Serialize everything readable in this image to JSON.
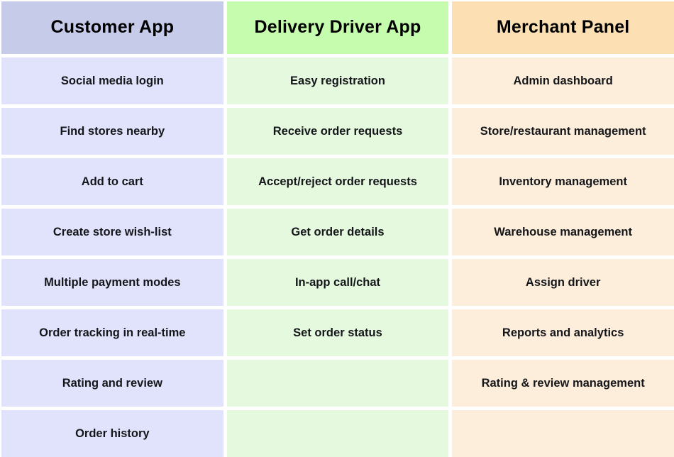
{
  "table": {
    "title": "Customer App / Delivery Driver App / Merchant Panel feature comparison",
    "columns": [
      {
        "id": "customer-app",
        "header": "Customer App",
        "header_color": "#c6cbea",
        "body_color": "#e1e3fd"
      },
      {
        "id": "delivery-driver-app",
        "header": "Delivery Driver App",
        "header_color": "#c6fcad",
        "body_color": "#e5f9df"
      },
      {
        "id": "merchant-panel",
        "header": "Merchant Panel",
        "header_color": "#fce0b4",
        "body_color": "#fdeedb"
      }
    ],
    "rows": [
      [
        "Social media login",
        "Easy registration",
        "Admin dashboard"
      ],
      [
        "Find stores nearby",
        "Receive order requests",
        "Store/restaurant management"
      ],
      [
        "Add to cart",
        "Accept/reject order requests",
        "Inventory management"
      ],
      [
        "Create store wish-list",
        "Get order details",
        "Warehouse management"
      ],
      [
        "Multiple payment modes",
        "In-app call/chat",
        "Assign driver"
      ],
      [
        "Order tracking in real-time",
        "Set order status",
        "Reports and analytics"
      ],
      [
        "Rating and review",
        "",
        "Rating & review management"
      ],
      [
        "Order history",
        "",
        ""
      ]
    ],
    "text_color": "#15161a",
    "header_text_color": "#000000",
    "gap_color": "#ffffff"
  }
}
